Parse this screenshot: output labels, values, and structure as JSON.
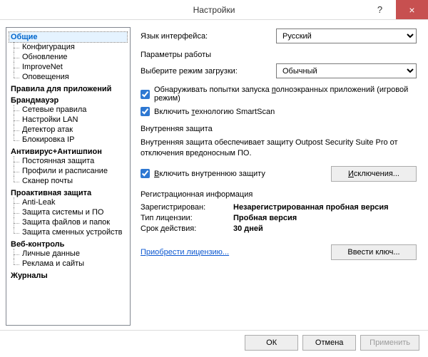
{
  "window": {
    "title": "Настройки",
    "help": "?",
    "close": "×"
  },
  "tree": {
    "general": "Общие",
    "general_items": [
      "Конфигурация",
      "Обновление",
      "ImproveNet",
      "Оповещения"
    ],
    "rules": "Правила для приложений",
    "firewall": "Брандмауэр",
    "firewall_items": [
      "Сетевые правила",
      "Настройки LAN",
      "Детектор атак",
      "Блокировка IP"
    ],
    "antivirus": "Антивирус+Антишпион",
    "antivirus_items": [
      "Постоянная защита",
      "Профили и расписание",
      "Сканер почты"
    ],
    "proactive": "Проактивная защита",
    "proactive_items": [
      "Anti-Leak",
      "Защита системы и ПО",
      "Защита файлов и папок",
      "Защита сменных устройств"
    ],
    "webcontrol": "Веб-контроль",
    "webcontrol_items": [
      "Личные данные",
      "Реклама и сайты"
    ],
    "logs": "Журналы"
  },
  "main": {
    "lang_label": "Язык интерфейса:",
    "lang_value": "Русский",
    "params_label": "Параметры работы",
    "mode_label": "Выберите режим загрузки:",
    "mode_value": "Обычный",
    "cb_fullscreen_pre": "Обнаруживать попытки запуска ",
    "cb_fullscreen_u": "п",
    "cb_fullscreen_post": "олноэкранных приложений (игровой режим)",
    "cb_smartscan_pre": "Включить ",
    "cb_smartscan_u": "т",
    "cb_smartscan_post": "ехнологию SmartScan",
    "inner_title": "Внутренняя защита",
    "inner_text": "Внутренняя защита обеспечивает защиту Outpost Security Suite Pro от отключения вредоносным ПО.",
    "cb_inner_u": "В",
    "cb_inner_post": "ключить внутреннюю защиту",
    "exclusions_u": "И",
    "exclusions_post": "сключения...",
    "reg_title": "Регистрационная информация",
    "reg_registered_label": "Зарегистрирован:",
    "reg_registered_val": "Незарегистрированная пробная версия",
    "reg_license_label": "Тип лицензии:",
    "reg_license_val": "Пробная версия",
    "reg_term_label": "Срок действия:",
    "reg_term_val": "30 дней",
    "buy_link": "Приобрести лицензию...",
    "enter_key": "Ввести ключ..."
  },
  "buttons": {
    "ok": "ОК",
    "cancel": "Отмена",
    "apply": "Применить"
  }
}
